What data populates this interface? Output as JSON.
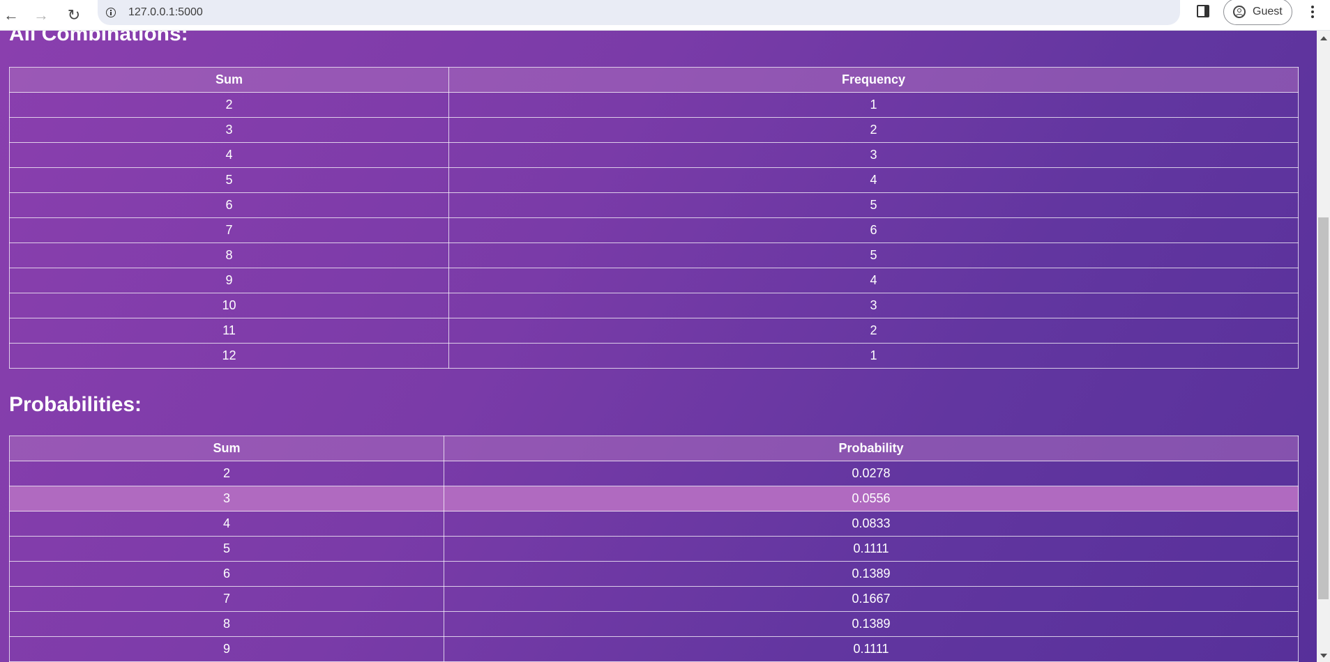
{
  "browser": {
    "url": "127.0.0.1:5000",
    "profile_label": "Guest",
    "back_icon": "←",
    "forward_icon": "→",
    "reload_icon": "↻"
  },
  "combinations": {
    "heading": "All Combinations:",
    "columns": [
      "Sum",
      "Frequency"
    ],
    "rows": [
      {
        "sum": "2",
        "frequency": "1"
      },
      {
        "sum": "3",
        "frequency": "2"
      },
      {
        "sum": "4",
        "frequency": "3"
      },
      {
        "sum": "5",
        "frequency": "4"
      },
      {
        "sum": "6",
        "frequency": "5"
      },
      {
        "sum": "7",
        "frequency": "6"
      },
      {
        "sum": "8",
        "frequency": "5"
      },
      {
        "sum": "9",
        "frequency": "4"
      },
      {
        "sum": "10",
        "frequency": "3"
      },
      {
        "sum": "11",
        "frequency": "2"
      },
      {
        "sum": "12",
        "frequency": "1"
      }
    ]
  },
  "probabilities": {
    "heading": "Probabilities:",
    "columns": [
      "Sum",
      "Probability"
    ],
    "highlighted_row": 1,
    "rows": [
      {
        "sum": "2",
        "probability": "0.0278"
      },
      {
        "sum": "3",
        "probability": "0.0556"
      },
      {
        "sum": "4",
        "probability": "0.0833"
      },
      {
        "sum": "5",
        "probability": "0.1111"
      },
      {
        "sum": "6",
        "probability": "0.1389"
      },
      {
        "sum": "7",
        "probability": "0.1667"
      },
      {
        "sum": "8",
        "probability": "0.1389"
      },
      {
        "sum": "9",
        "probability": "0.1111"
      }
    ]
  }
}
